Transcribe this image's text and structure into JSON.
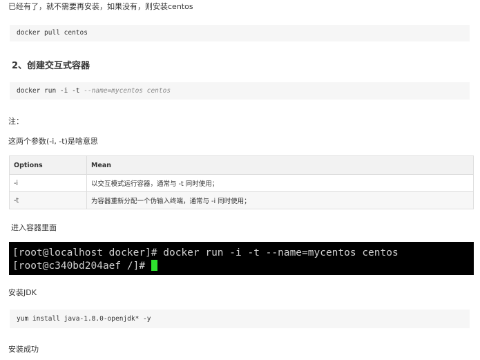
{
  "intro_text": "已经有了，就不需要再安装，如果没有，则安装centos",
  "code_pull": "docker pull centos",
  "heading_2": "2、创建交互式容器",
  "code_run": {
    "cmd": "docker run -i -t ",
    "opts": "--name=mycentos centos"
  },
  "note_label": "注：",
  "params_text": "这两个参数(-i, -t)是啥意思",
  "table": {
    "headers": [
      "Options",
      "Mean"
    ],
    "rows": [
      [
        "-i",
        "以交互模式运行容器，通常与 -t 同时使用；"
      ],
      [
        "-t",
        "为容器重新分配一个伪输入终端，通常与 -i 同时使用；"
      ]
    ]
  },
  "enter_text": "进入容器里面",
  "terminal": {
    "line1": "[root@localhost docker]# docker run -i -t --name=mycentos centos",
    "line2": "[root@c340bd204aef /]# "
  },
  "install_jdk_text": "安装JDK",
  "code_yum": "yum install java-1.8.0-openjdk* -y",
  "success_text": "安装成功"
}
